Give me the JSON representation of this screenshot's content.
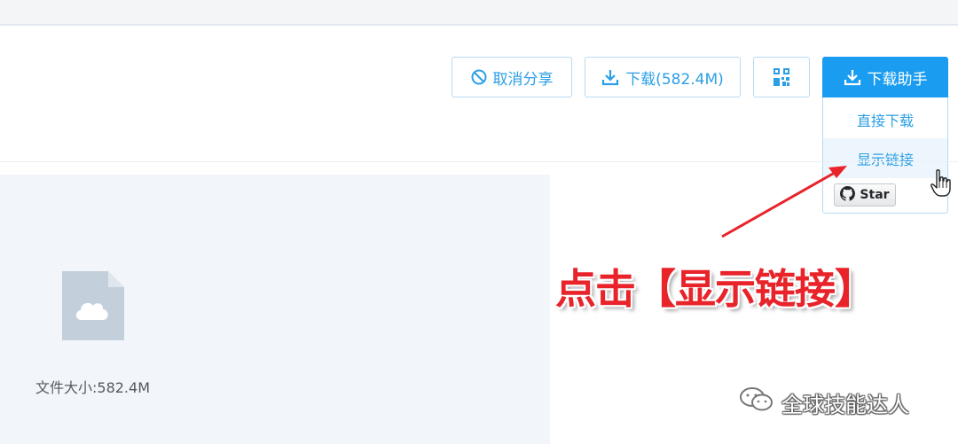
{
  "toolbar": {
    "cancel_share_label": "取消分享",
    "download_label": "下载(582.4M)",
    "download_helper_label": "下载助手"
  },
  "dropdown": {
    "items": [
      {
        "label": "直接下载"
      },
      {
        "label": "显示链接"
      }
    ],
    "star_label": "Star"
  },
  "file": {
    "size_label": "文件大小:582.4M"
  },
  "annotation": {
    "text": "点击【显示链接】"
  },
  "watermark": {
    "text": "全球技能达人"
  },
  "colors": {
    "accent": "#1a9cf0",
    "annotation": "#e8232a",
    "preview_bg": "#f2f6fb"
  },
  "icons": [
    "ban-icon",
    "download-icon",
    "qrcode-icon",
    "github-icon",
    "cloud-file-icon",
    "hand-cursor-icon",
    "wechat-icon"
  ]
}
